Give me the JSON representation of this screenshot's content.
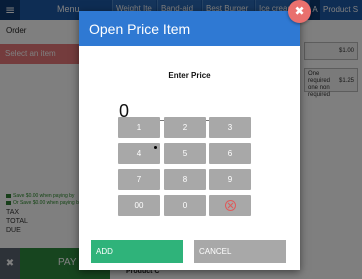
{
  "app": {
    "menu_icon": "≡",
    "menu_label": "Menu",
    "header_tabs": [
      "Weight Ite",
      "Band-aid",
      "Best Burger",
      "Ice cream S"
    ],
    "header_a": "A",
    "header_product": "Product S",
    "order_label": "Order",
    "select_item": "Select an item",
    "right_price_1": "$1.00",
    "right_required_text": "One required one non required",
    "right_required_price": "$1.25",
    "save_note_1": "Save $0.00 when paying by",
    "save_note_2": "Or Save $0.00 when paying by",
    "tax": "TAX",
    "total": "TOTAL",
    "due": "DUE",
    "cancel_icon": "✖",
    "pay_label": "PAY",
    "product_c": "Product C"
  },
  "dialog": {
    "title": "Open Price Item",
    "close_icon": "✖",
    "prompt": "Enter Price",
    "amount": "0",
    "keys": [
      "1",
      "2",
      "3",
      "4",
      "5",
      "6",
      "7",
      "8",
      "9",
      "00",
      "0"
    ],
    "backspace_icon": "clear-icon",
    "add_label": "ADD",
    "cancel_label": "CANCEL"
  },
  "colors": {
    "header_blue": "#2f79d3",
    "add_green": "#2fb37a",
    "close_red": "#e9706e",
    "key_gray": "#a8a8a8"
  }
}
